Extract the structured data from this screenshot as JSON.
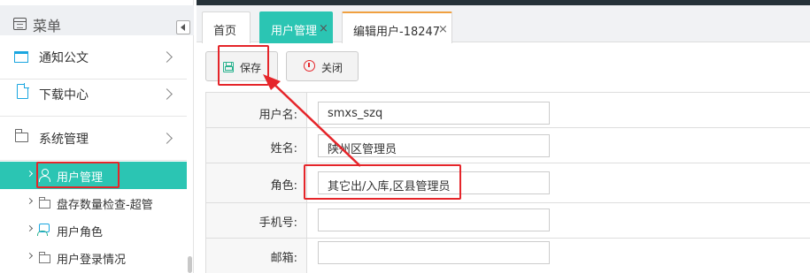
{
  "sidebar": {
    "title": "菜单",
    "items": [
      {
        "label": "通知公文"
      },
      {
        "label": "下载中心"
      },
      {
        "label": "系统管理"
      }
    ],
    "sub_items": [
      {
        "label": "用户管理"
      },
      {
        "label": "盘存数量检查-超管"
      },
      {
        "label": "用户角色"
      },
      {
        "label": "用户登录情况"
      }
    ]
  },
  "tabs": [
    {
      "label": "首页"
    },
    {
      "label": "用户管理",
      "close": "×"
    },
    {
      "label": "编辑用户-18247",
      "close": "×"
    }
  ],
  "toolbar": {
    "save_label": "保存",
    "close_label": "关闭"
  },
  "form": {
    "rows": [
      {
        "label": "用户名:",
        "value": "smxs_szq"
      },
      {
        "label": "姓名:",
        "value": "陕州区管理员"
      },
      {
        "label": "角色:",
        "value": "其它出/入库,区县管理员"
      },
      {
        "label": "手机号:",
        "value": ""
      },
      {
        "label": "邮箱:",
        "value": ""
      }
    ]
  },
  "colors": {
    "accent": "#2bc5b3",
    "highlight": "#e5252a",
    "topbar": "#263238"
  }
}
